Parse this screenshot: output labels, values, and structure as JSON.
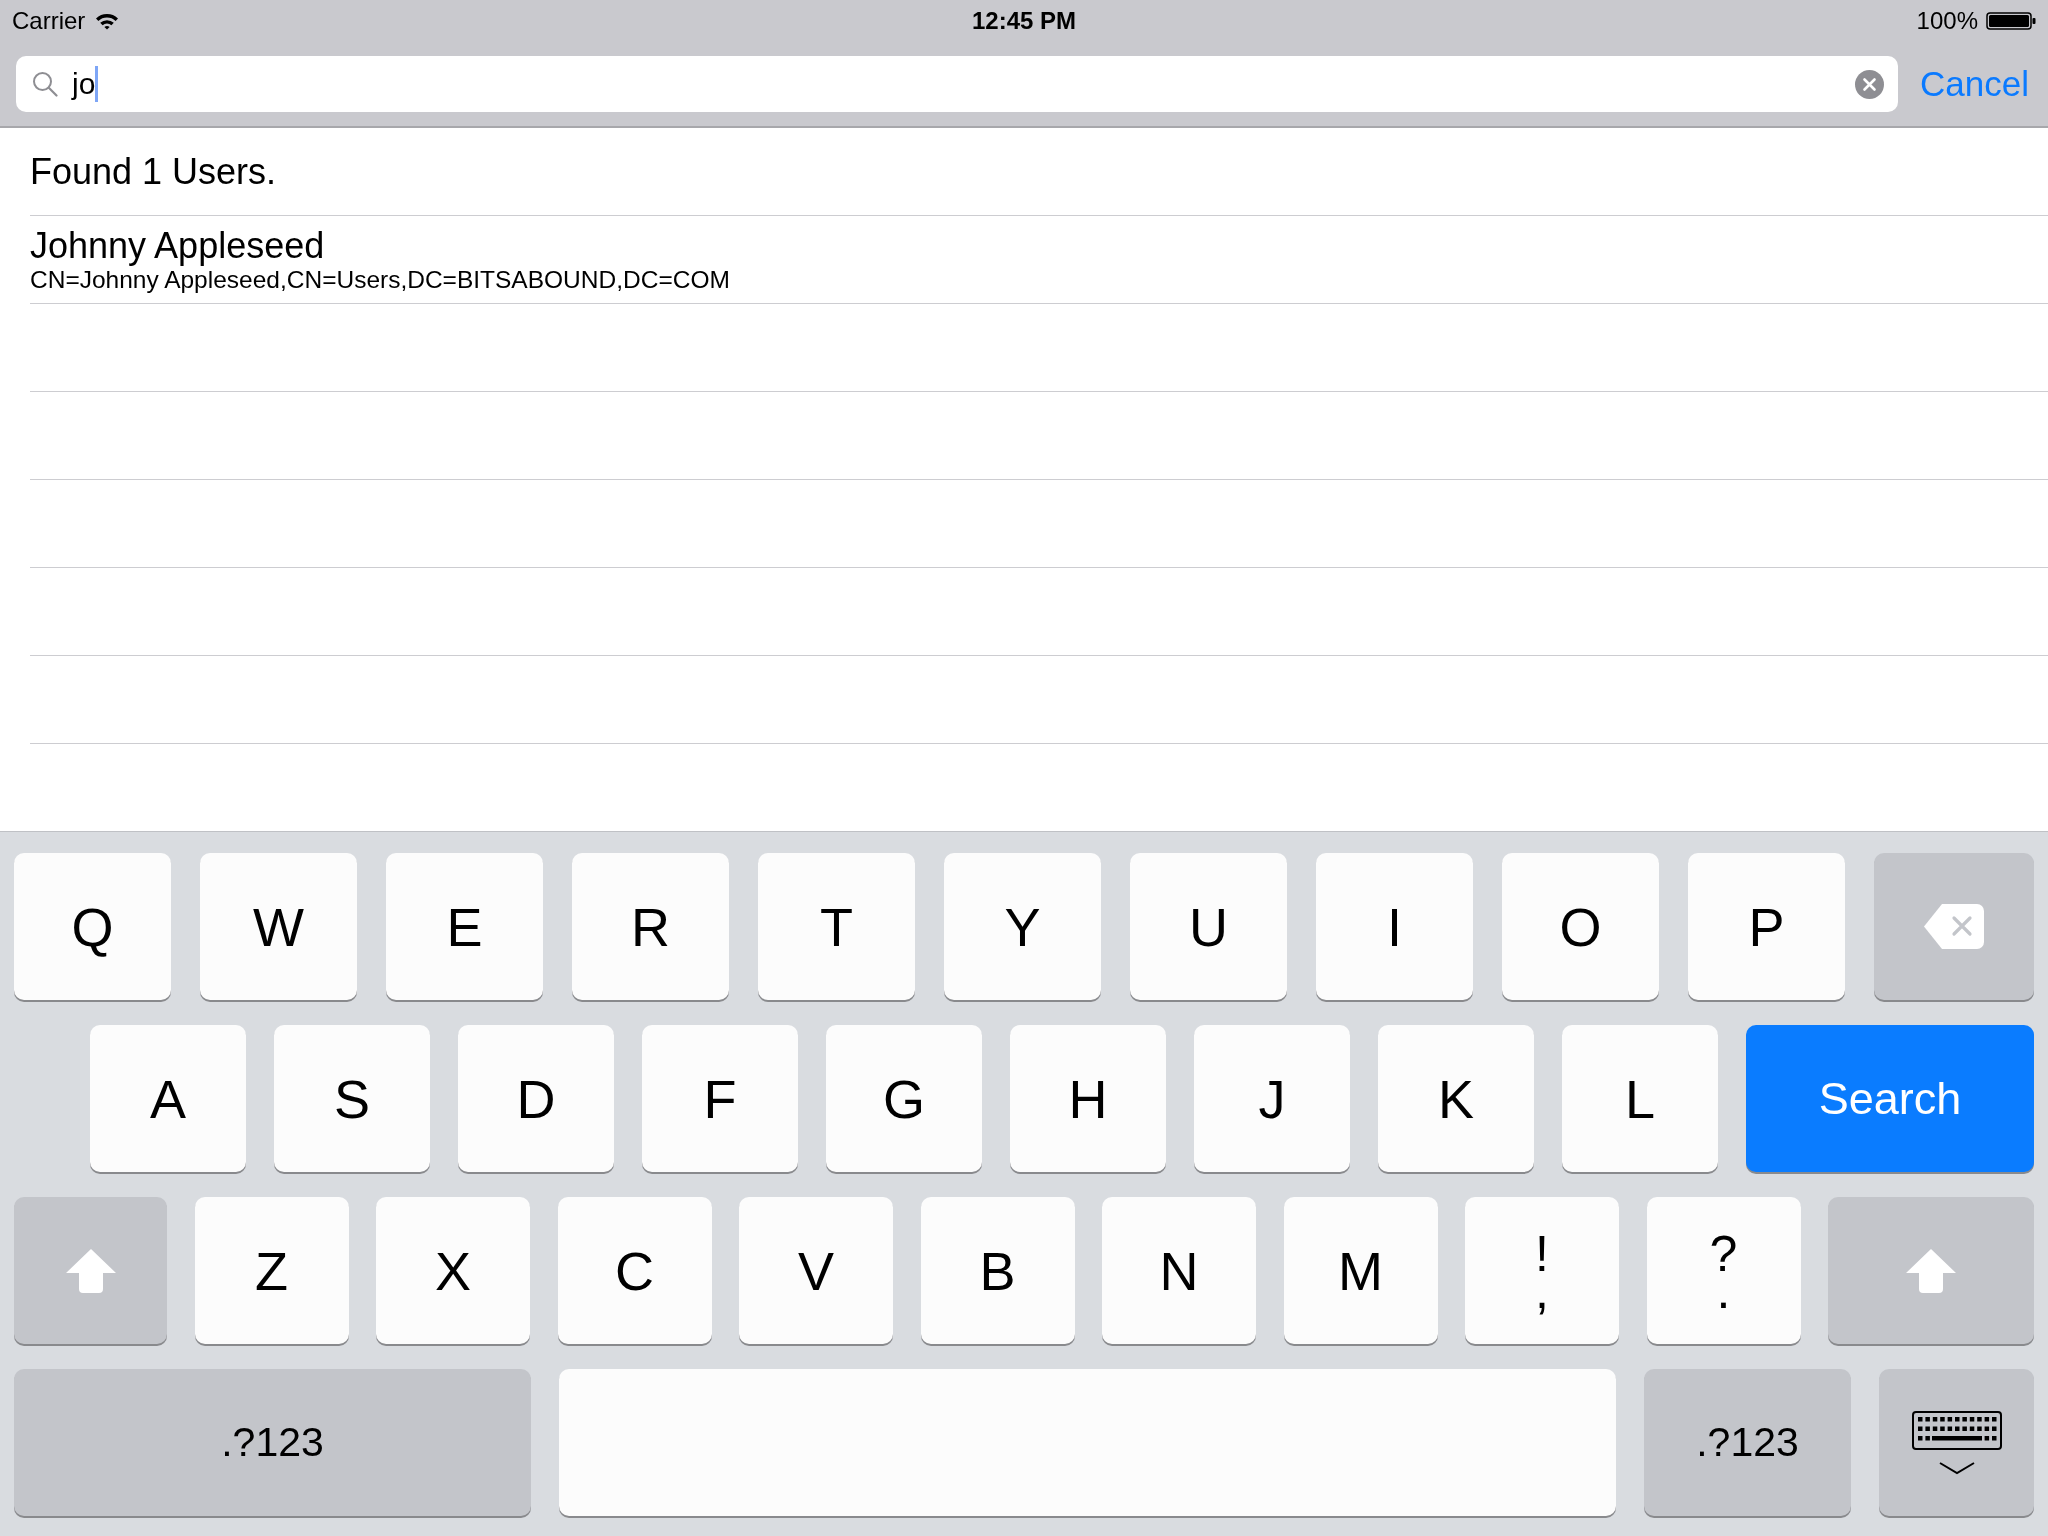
{
  "status_bar": {
    "carrier": "Carrier",
    "time": "12:45 PM",
    "battery": "100%"
  },
  "search_bar": {
    "value": "jo",
    "cancel": "Cancel"
  },
  "results": {
    "summary": "Found 1 Users.",
    "rows": [
      {
        "name": "Johnny Appleseed",
        "detail": "CN=Johnny Appleseed,CN=Users,DC=BITSABOUND,DC=COM"
      }
    ]
  },
  "keyboard": {
    "key_rows": [
      {
        "keys": [
          {
            "kind": "letter",
            "label": "Q"
          },
          {
            "kind": "letter",
            "label": "W"
          },
          {
            "kind": "letter",
            "label": "E"
          },
          {
            "kind": "letter",
            "label": "R"
          },
          {
            "kind": "letter",
            "label": "T"
          },
          {
            "kind": "letter",
            "label": "Y"
          },
          {
            "kind": "letter",
            "label": "U"
          },
          {
            "kind": "letter",
            "label": "I"
          },
          {
            "kind": "letter",
            "label": "O"
          },
          {
            "kind": "letter",
            "label": "P"
          },
          {
            "kind": "backspace"
          }
        ]
      },
      {
        "keys": [
          {
            "kind": "letter",
            "label": "A"
          },
          {
            "kind": "letter",
            "label": "S"
          },
          {
            "kind": "letter",
            "label": "D"
          },
          {
            "kind": "letter",
            "label": "F"
          },
          {
            "kind": "letter",
            "label": "G"
          },
          {
            "kind": "letter",
            "label": "H"
          },
          {
            "kind": "letter",
            "label": "J"
          },
          {
            "kind": "letter",
            "label": "K"
          },
          {
            "kind": "letter",
            "label": "L"
          },
          {
            "kind": "action",
            "label": "Search"
          }
        ]
      },
      {
        "keys": [
          {
            "kind": "shift"
          },
          {
            "kind": "letter",
            "label": "Z"
          },
          {
            "kind": "letter",
            "label": "X"
          },
          {
            "kind": "letter",
            "label": "C"
          },
          {
            "kind": "letter",
            "label": "V"
          },
          {
            "kind": "letter",
            "label": "B"
          },
          {
            "kind": "letter",
            "label": "N"
          },
          {
            "kind": "letter",
            "label": "M"
          },
          {
            "kind": "punct",
            "label": "!",
            "alt": ","
          },
          {
            "kind": "punct",
            "label": "?",
            "alt": "."
          },
          {
            "kind": "shift"
          }
        ]
      },
      {
        "keys": [
          {
            "kind": "mode",
            "label": ".?123"
          },
          {
            "kind": "space"
          },
          {
            "kind": "mode",
            "label": ".?123"
          },
          {
            "kind": "dismiss"
          }
        ]
      }
    ]
  }
}
